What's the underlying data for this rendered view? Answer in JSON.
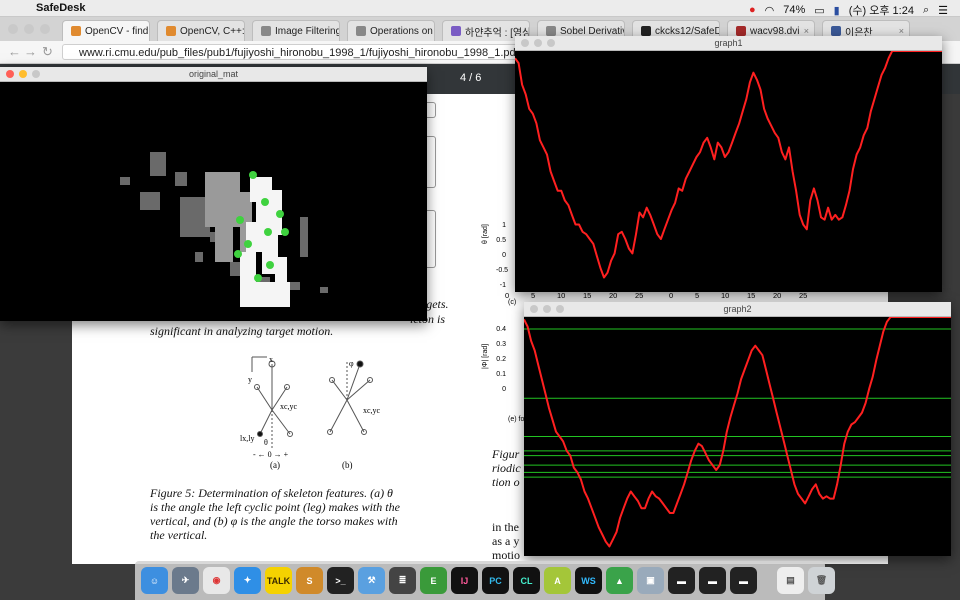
{
  "menubar": {
    "app_name": "SafeDesk",
    "battery": "74%",
    "clock": "(수) 오후 1:24"
  },
  "browser": {
    "tabs": [
      {
        "label": "OpenCV - find",
        "color": "#e08a2f"
      },
      {
        "label": "OpenCV, C++: C",
        "color": "#e08a2f"
      },
      {
        "label": "Image Filtering",
        "color": "#888888"
      },
      {
        "label": "Operations on A",
        "color": "#888888"
      },
      {
        "label": "하얀추억 : [영상처",
        "color": "#7a5cc4"
      },
      {
        "label": "Sobel Derivative",
        "color": "#888888"
      },
      {
        "label": "ckcks12/SafeD",
        "color": "#222222"
      },
      {
        "label": "wacv98.dvi",
        "color": "#a52a2a"
      },
      {
        "label": "이은찬",
        "color": "#3b5998"
      }
    ],
    "url": "www.ri.cmu.edu/pub_files/pub1/fujiyoshi_hironobu_1998_1/fujiyoshi_hironobu_1998_1.pdf"
  },
  "pdf": {
    "page_counter": "4 / 6",
    "right_text_1": "rgets.",
    "right_text_2": "leton is",
    "line_1": "significant in analyzing target motion.",
    "caption_1": "Figure 5:  Determination of skeleton features.  (a) θ",
    "caption_2": "is the angle the left cyclic point (leg) makes with the",
    "caption_3": "vertical, and (b) φ is the angle the torso makes with",
    "caption_4": "the vertical.",
    "fig_a": "(a)",
    "fig_b": "(b)",
    "fig_label_x": "x",
    "fig_label_y": "y",
    "fig_label_xc": "xc,yc",
    "fig_label_lx": "lx,ly",
    "fig_label_theta": "θ",
    "fig_label_phi": "φ",
    "fig_label_pm": "- ← 0 → +",
    "right_col_1": "Figur",
    "right_col_2": "riodic",
    "right_col_3": "tion o",
    "right_col_4": "in the",
    "right_col_5": "as a y",
    "right_col_6": "motio",
    "plot_axis_label": "θ [rad]",
    "plot_axis_label_2": "|Φ| [rad]",
    "plot_ticks_x": [
      "0",
      "5",
      "10",
      "15",
      "20",
      "25",
      "0",
      "5",
      "10",
      "15",
      "20",
      "25"
    ],
    "plot_ticks_y": [
      "1",
      "0.5",
      "0",
      "-0.5",
      "-1"
    ],
    "plot_ticks_y2": [
      "0.4",
      "0.3",
      "0.2",
      "0.1",
      "0"
    ],
    "plot_sub_c": "(c)",
    "plot_sub_e": "(e) fo"
  },
  "windows": {
    "original_mat": "original_mat",
    "graph1": "graph1",
    "graph2": "graph2"
  },
  "colors": {
    "curve": "#ff2020",
    "line_green": "#22c422",
    "point_green": "#3fd23f"
  },
  "chart_data": [
    {
      "type": "line",
      "title": "graph1",
      "x": [
        0,
        3,
        6,
        9,
        12,
        15,
        18,
        21,
        24,
        27,
        30,
        33,
        36,
        39,
        42,
        45,
        48,
        51,
        54,
        57,
        60,
        63,
        66,
        69,
        72,
        75,
        78,
        81,
        84,
        87,
        90,
        93,
        96,
        99,
        102,
        105,
        108,
        111,
        114,
        117,
        120,
        123,
        126,
        129,
        132,
        135,
        138,
        141,
        144,
        147,
        150,
        153,
        156,
        159,
        162,
        165,
        168,
        171,
        174,
        177,
        180,
        183,
        186,
        189,
        192,
        195,
        198,
        201,
        204,
        207,
        210,
        213,
        216,
        219,
        222,
        225,
        228,
        231,
        234,
        237,
        240,
        243,
        246,
        249,
        252,
        255,
        258,
        261,
        264,
        267,
        270,
        273,
        276,
        279,
        282,
        285,
        288,
        291,
        294,
        297,
        300,
        303,
        306,
        309,
        312,
        315,
        318,
        321,
        324,
        327,
        330,
        333,
        336,
        339,
        342,
        345,
        348,
        351,
        354,
        357,
        360
      ],
      "y": [
        0.97,
        0.95,
        0.86,
        0.82,
        0.76,
        0.74,
        0.7,
        0.63,
        0.6,
        0.57,
        0.5,
        0.46,
        0.42,
        0.42,
        0.38,
        0.36,
        0.32,
        0.28,
        0.28,
        0.25,
        0.24,
        0.22,
        0.2,
        0.15,
        0.1,
        0.06,
        0.08,
        0.13,
        0.16,
        0.24,
        0.25,
        0.22,
        0.18,
        0.16,
        0.24,
        0.33,
        0.31,
        0.35,
        0.32,
        0.28,
        0.24,
        0.22,
        0.26,
        0.3,
        0.34,
        0.37,
        0.43,
        0.42,
        0.47,
        0.5,
        0.53,
        0.56,
        0.58,
        0.62,
        0.64,
        0.6,
        0.55,
        0.62,
        0.6,
        0.56,
        0.58,
        0.62,
        0.66,
        0.7,
        0.75,
        0.8,
        0.87,
        0.91,
        0.88,
        0.84,
        0.76,
        0.72,
        0.69,
        0.66,
        0.64,
        0.58,
        0.55,
        0.6,
        0.5,
        0.42,
        0.32,
        0.28,
        0.26,
        0.38,
        0.43,
        0.38,
        0.31,
        0.3,
        0.35,
        0.3,
        0.32,
        0.3,
        0.31,
        0.36,
        0.42,
        0.51,
        0.57,
        0.6,
        0.65,
        0.68,
        0.75,
        0.8,
        0.85,
        0.9,
        0.93,
        0.97,
        1.0,
        1.0,
        1.0,
        1.0,
        1.0,
        1.0,
        1.0,
        1.0,
        1.0,
        1.0,
        1.0,
        1.0,
        1.0,
        1.0,
        1.0
      ],
      "ylim": [
        0,
        1
      ],
      "grid": false
    },
    {
      "type": "line",
      "title": "graph2",
      "x": [
        0,
        3,
        6,
        9,
        12,
        15,
        18,
        21,
        24,
        27,
        30,
        33,
        36,
        39,
        42,
        45,
        48,
        51,
        54,
        57,
        60,
        63,
        66,
        69,
        72,
        75,
        78,
        81,
        84,
        87,
        90,
        93,
        96,
        99,
        102,
        105,
        108,
        111,
        114,
        117,
        120,
        123,
        126,
        129,
        132,
        135,
        138,
        141,
        144,
        147,
        150,
        153,
        156,
        159,
        162,
        165,
        168,
        171,
        174,
        177,
        180,
        183,
        186,
        189,
        192,
        195,
        198,
        201,
        204,
        207,
        210,
        213,
        216,
        219,
        222,
        225,
        228,
        231,
        234,
        237,
        240,
        243,
        246,
        249,
        252,
        255,
        258,
        261,
        264,
        267,
        270,
        273,
        276,
        279,
        282,
        285,
        288,
        291,
        294,
        297,
        300,
        303,
        306,
        309,
        312,
        315,
        318,
        321,
        324,
        327,
        330,
        333,
        336,
        339,
        342,
        345,
        348,
        351,
        354,
        357,
        360
      ],
      "y": [
        0.99,
        0.96,
        0.9,
        0.86,
        0.8,
        0.74,
        0.68,
        0.62,
        0.57,
        0.52,
        0.5,
        0.48,
        0.44,
        0.42,
        0.37,
        0.35,
        0.32,
        0.27,
        0.24,
        0.2,
        0.16,
        0.12,
        0.09,
        0.06,
        0.04,
        0.07,
        0.1,
        0.16,
        0.2,
        0.24,
        0.27,
        0.25,
        0.23,
        0.2,
        0.2,
        0.24,
        0.27,
        0.25,
        0.24,
        0.22,
        0.2,
        0.18,
        0.18,
        0.22,
        0.26,
        0.3,
        0.35,
        0.4,
        0.44,
        0.47,
        0.46,
        0.43,
        0.4,
        0.38,
        0.36,
        0.38,
        0.44,
        0.52,
        0.58,
        0.63,
        0.68,
        0.74,
        0.78,
        0.82,
        0.86,
        0.88,
        0.86,
        0.84,
        0.78,
        0.72,
        0.66,
        0.6,
        0.54,
        0.48,
        0.42,
        0.36,
        0.3,
        0.26,
        0.24,
        0.22,
        0.25,
        0.28,
        0.3,
        0.26,
        0.24,
        0.25,
        0.24,
        0.24,
        0.3,
        0.38,
        0.47,
        0.52,
        0.55,
        0.56,
        0.58,
        0.6,
        0.64,
        0.7,
        0.75,
        0.82,
        0.88,
        0.94,
        0.98,
        1.0,
        1.0,
        1.0,
        1.0,
        1.0,
        1.0,
        1.0,
        1.0,
        1.0,
        1.0,
        1.0,
        1.0,
        1.0,
        1.0,
        1.0,
        1.0,
        1.0,
        1.0
      ],
      "hlines": [
        0.95,
        0.66,
        0.5,
        0.44,
        0.42,
        0.38,
        0.35,
        0.33
      ],
      "ylim": [
        0,
        1
      ],
      "grid": false
    }
  ]
}
